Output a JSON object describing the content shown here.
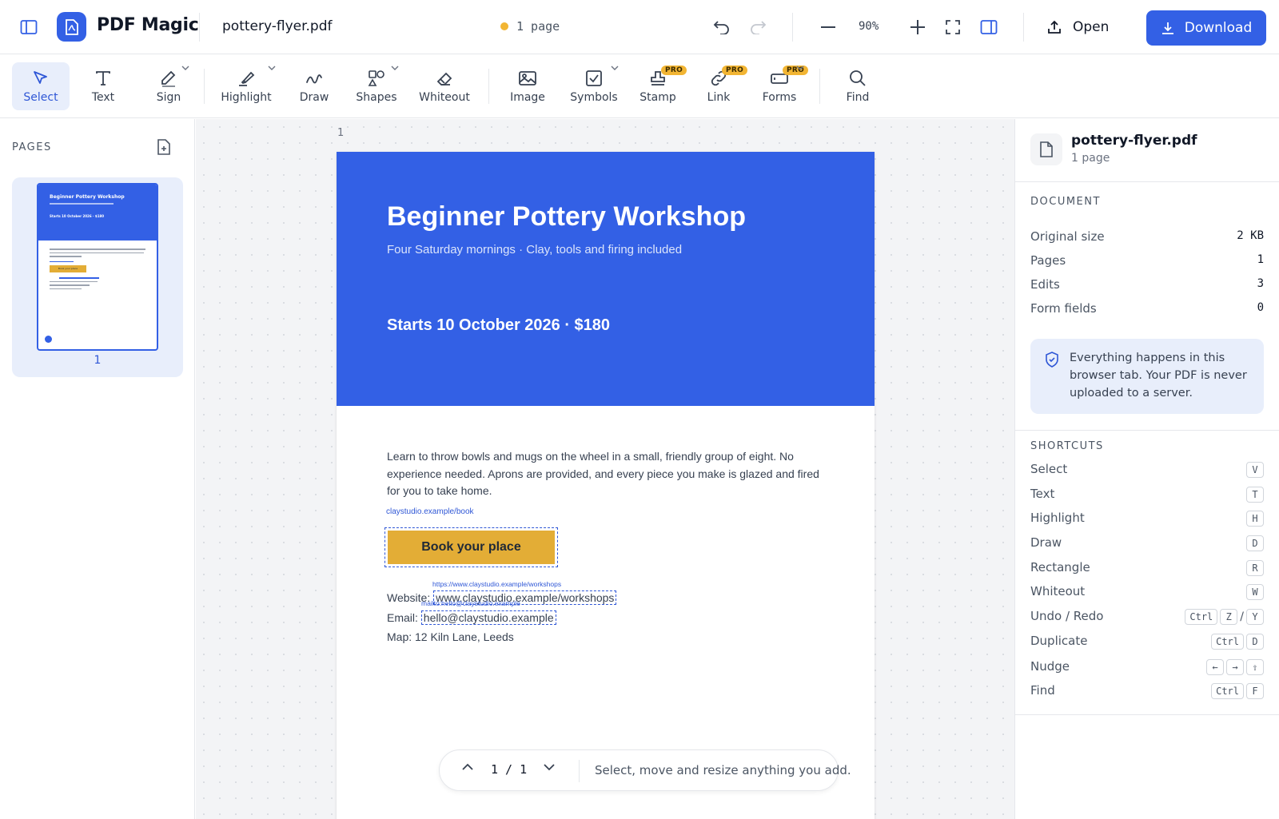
{
  "app": {
    "title": "PDF Magic",
    "file_name": "pottery-flyer.pdf",
    "page_status": "1 page",
    "zoom": "90%",
    "open_label": "Open",
    "download_label": "Download",
    "accent_color": "#3360e5"
  },
  "toolbar": {
    "tools": [
      {
        "label": "Select",
        "icon": "cursor-icon",
        "active": true
      },
      {
        "label": "Text",
        "icon": "text-icon"
      },
      {
        "label": "Sign",
        "icon": "pen-icon",
        "dropdown": true
      },
      {
        "label": "Highlight",
        "icon": "highlighter-icon",
        "dropdown": true
      },
      {
        "label": "Draw",
        "icon": "squiggle-icon"
      },
      {
        "label": "Shapes",
        "icon": "shapes-icon",
        "dropdown": true
      },
      {
        "label": "Whiteout",
        "icon": "eraser-icon"
      },
      {
        "label": "Image",
        "icon": "image-icon"
      },
      {
        "label": "Symbols",
        "icon": "checkbox-icon",
        "dropdown": true
      },
      {
        "label": "Stamp",
        "icon": "stamp-icon",
        "pro": true
      },
      {
        "label": "Link",
        "icon": "link-icon",
        "pro": true
      },
      {
        "label": "Forms",
        "icon": "form-icon",
        "pro": true,
        "dropdown": true
      },
      {
        "label": "Find",
        "icon": "search-icon"
      }
    ],
    "pro_badge": "PRO"
  },
  "pages_panel": {
    "label": "PAGES",
    "thumb_number": "1",
    "thumb_title": "Beginner Pottery Workshop",
    "thumb_date": "Starts 10 October 2026 · $180",
    "thumb_button": "Book your place"
  },
  "document": {
    "page_index": "1",
    "title": "Beginner Pottery Workshop",
    "subtitle": "Four Saturday mornings  ·  Clay, tools and firing included",
    "date_line": "Starts 10 October 2026  ·  $180",
    "body": "Learn to throw bowls and mugs on the wheel in a small, friendly group of eight. No experience needed. Aprons are provided, and every piece you make is glazed and fired for you to take home.",
    "book_link_tag": "claystudio.example/book",
    "book_button": "Book your place",
    "website_link_tag": "https://www.claystudio.example/workshops",
    "website_label": "Website:",
    "website_value": "www.claystudio.example/workshops",
    "email_link_tag": "mailto:hello@claystudio.example",
    "email_label": "Email:",
    "email_value": "hello@claystudio.example",
    "map_label": "Map:",
    "map_value": "12 Kiln Lane, Leeds"
  },
  "page_nav": {
    "count": "1 / 1",
    "hint": "Select, move and resize anything you add."
  },
  "info_panel": {
    "file_name": "pottery-flyer.pdf",
    "pages": "1 page",
    "document_section": "DOCUMENT",
    "rows": [
      {
        "label": "Original size",
        "value": "2 KB"
      },
      {
        "label": "Pages",
        "value": "1"
      },
      {
        "label": "Edits",
        "value": "3"
      },
      {
        "label": "Form fields",
        "value": "0"
      }
    ],
    "privacy_note": "Everything happens in this browser tab. Your PDF is never uploaded to a server.",
    "shortcuts_section": "SHORTCUTS",
    "shortcuts": [
      {
        "label": "Select",
        "keys": [
          "V"
        ]
      },
      {
        "label": "Text",
        "keys": [
          "T"
        ]
      },
      {
        "label": "Highlight",
        "keys": [
          "H"
        ]
      },
      {
        "label": "Draw",
        "keys": [
          "D"
        ]
      },
      {
        "label": "Rectangle",
        "keys": [
          "R"
        ]
      },
      {
        "label": "Whiteout",
        "keys": [
          "W"
        ]
      },
      {
        "label": "Undo / Redo",
        "keys": [
          "Ctrl",
          "Z",
          "/",
          "Y"
        ]
      },
      {
        "label": "Duplicate",
        "keys": [
          "Ctrl",
          "D"
        ]
      },
      {
        "label": "Nudge",
        "keys": [
          "←",
          "→",
          "⇧"
        ]
      },
      {
        "label": "Find",
        "keys": [
          "Ctrl",
          "F"
        ]
      }
    ]
  }
}
